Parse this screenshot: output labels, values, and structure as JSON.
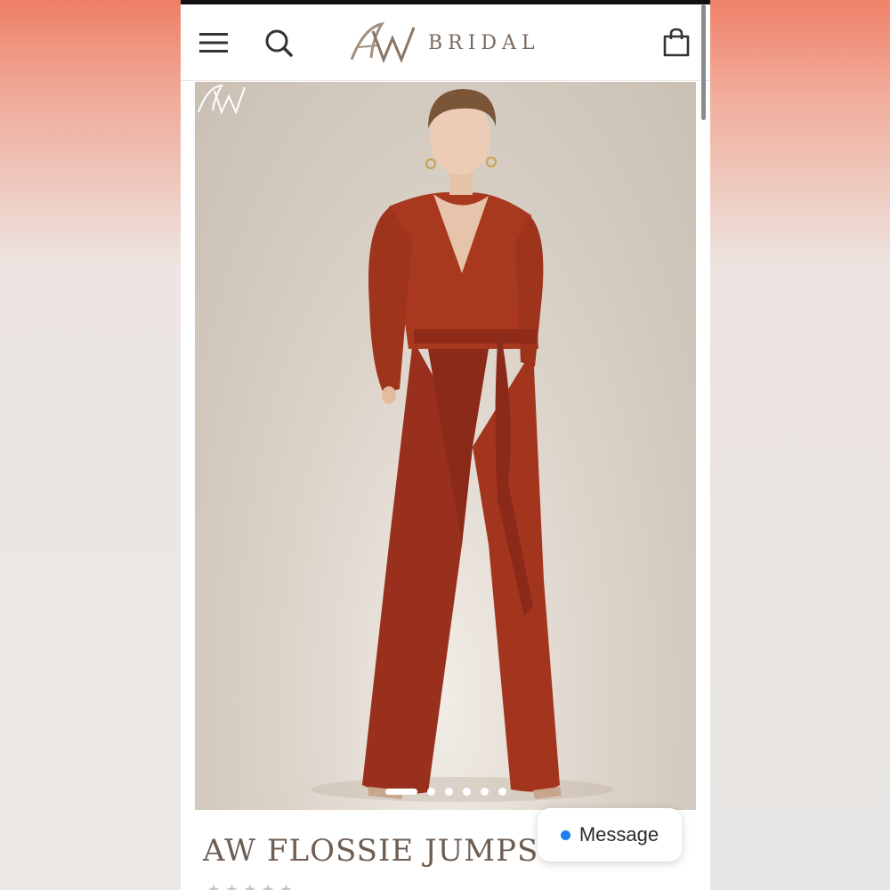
{
  "header": {
    "brand": "BRIDAL",
    "logo_mark": "AW"
  },
  "icons": {
    "menu": "menu-icon",
    "search": "search-icon",
    "cart": "cart-icon"
  },
  "product": {
    "title": "AW FLOSSIE JUMPSUIT",
    "image_watermark": "AW",
    "carousel": {
      "total": 6,
      "active": 1
    }
  },
  "chat": {
    "label": "Message"
  },
  "colors": {
    "brand_text": "#7a6a5e",
    "jumpsuit": "#a33a24",
    "message_dot": "#1d7ef0"
  }
}
